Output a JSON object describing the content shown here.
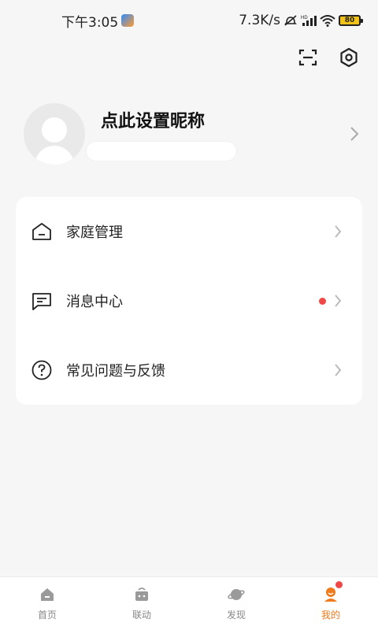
{
  "status_bar": {
    "time": "下午3:05",
    "net_speed": "7.3K/s",
    "battery": "80"
  },
  "profile": {
    "nickname": "点此设置昵称"
  },
  "menu": {
    "items": [
      {
        "label": "家庭管理",
        "icon": "home-icon"
      },
      {
        "label": "消息中心",
        "icon": "message-icon",
        "has_dot": true
      },
      {
        "label": "常见问题与反馈",
        "icon": "help-icon"
      }
    ]
  },
  "tabbar": {
    "tabs": [
      {
        "label": "首页",
        "icon": "home-tab-icon"
      },
      {
        "label": "联动",
        "icon": "linkage-tab-icon"
      },
      {
        "label": "发现",
        "icon": "discover-tab-icon"
      },
      {
        "label": "我的",
        "icon": "mine-tab-icon",
        "active": true
      }
    ]
  },
  "colors": {
    "accent": "#f07a1c",
    "dot": "#f04747",
    "background": "#f6f6f6"
  }
}
